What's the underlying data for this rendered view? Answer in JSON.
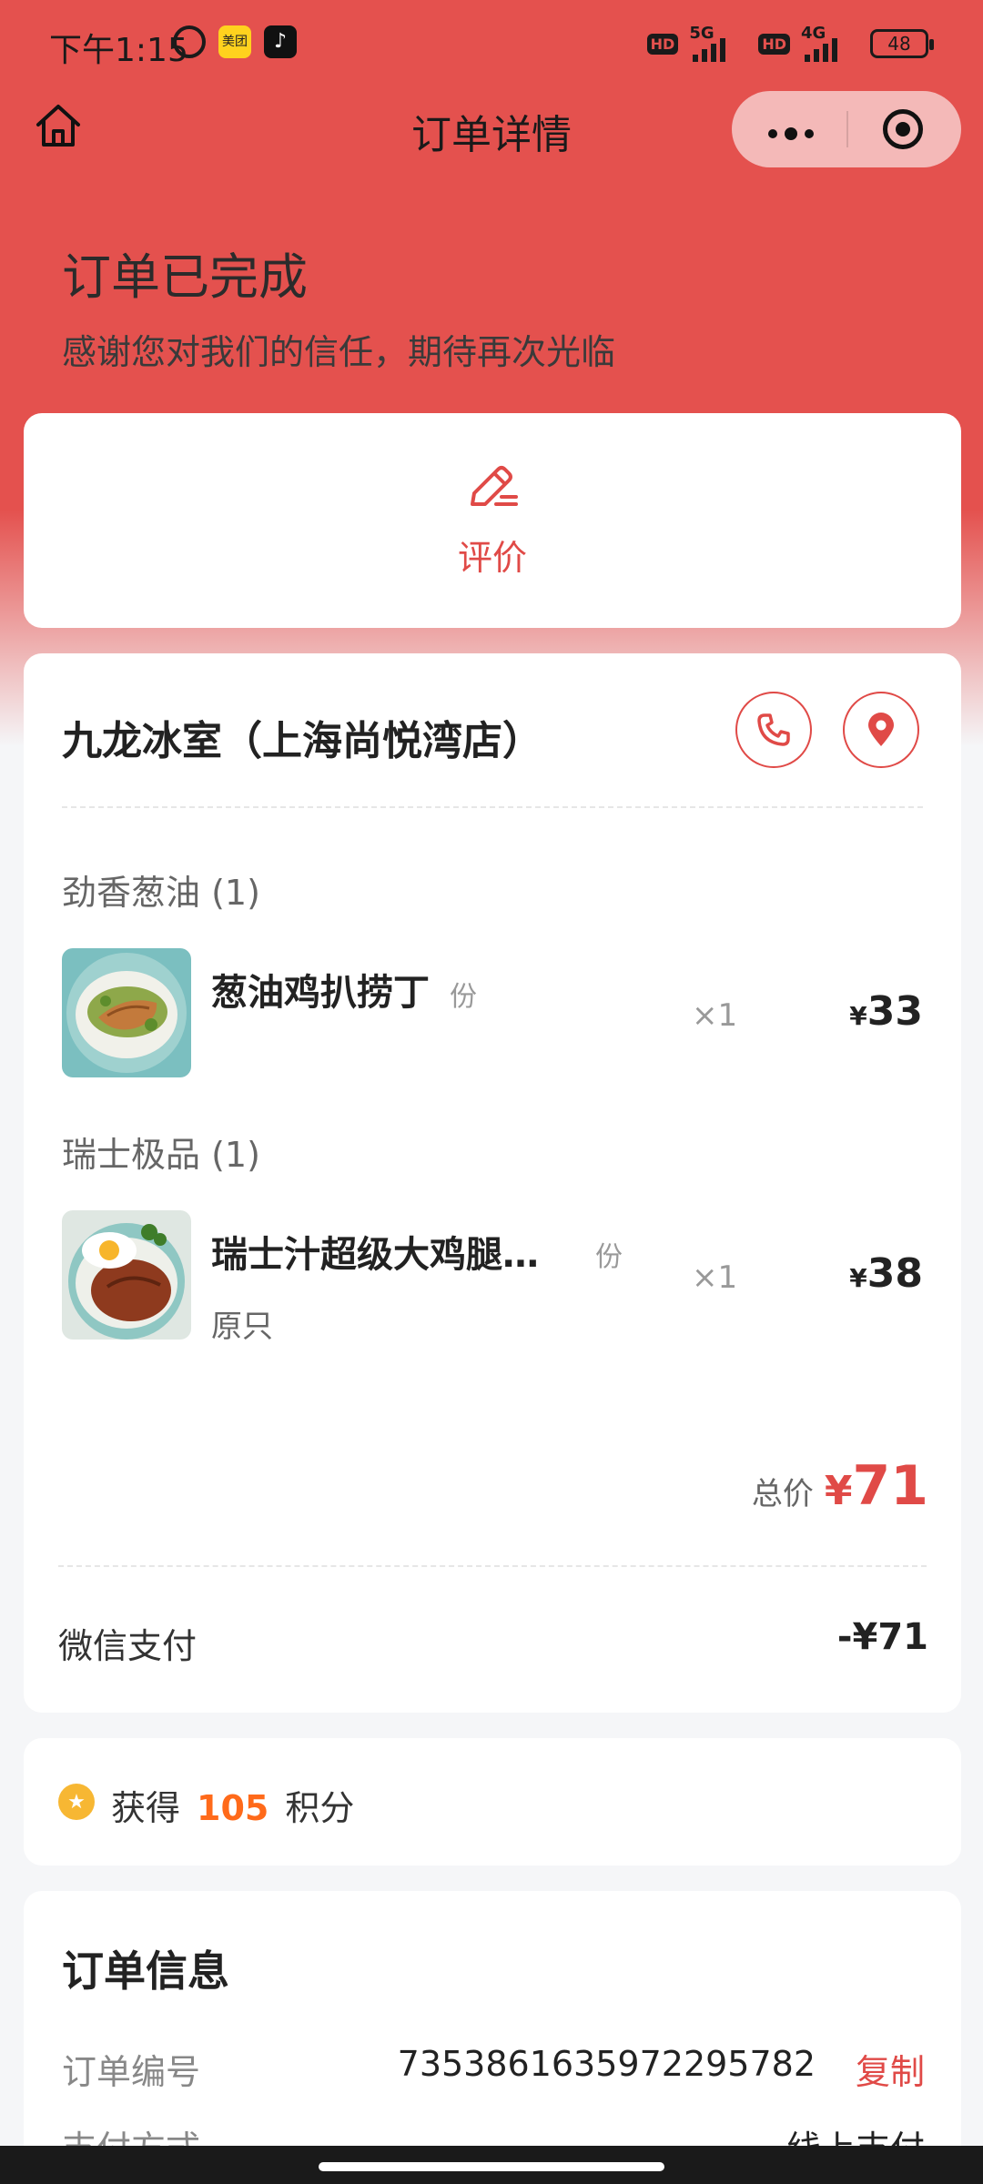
{
  "status_bar": {
    "time": "下午1:15",
    "app_badge_1": "美团",
    "app_badge_2": "♪",
    "hd_label": "HD",
    "net_1": "5G",
    "net_2": "4G",
    "battery": "48"
  },
  "nav": {
    "title": "订单详情"
  },
  "order_status": {
    "title": "订单已完成",
    "subtitle": "感谢您对我们的信任，期待再次光临"
  },
  "review": {
    "label": "评价"
  },
  "shop": {
    "name": "九龙冰室（上海尚悦湾店）"
  },
  "groups": [
    {
      "title": "劲香葱油 (1)",
      "item": {
        "name": "葱油鸡扒捞丁",
        "unit": "份",
        "spec": "",
        "qty": "×1",
        "currency": "¥",
        "price": "33"
      }
    },
    {
      "title": "瑞士极品 (1)",
      "item": {
        "name": "瑞士汁超级大鸡腿…",
        "unit": "份",
        "spec": "原只",
        "qty": "×1",
        "currency": "¥",
        "price": "38"
      }
    }
  ],
  "total": {
    "label": "总价",
    "currency": "¥",
    "amount": "71"
  },
  "payment": {
    "label": "微信支付",
    "amount": "-¥71"
  },
  "points": {
    "prefix": "获得",
    "value": "105",
    "suffix": "积分"
  },
  "order_info": {
    "title": "订单信息",
    "order_no_label": "订单编号",
    "order_no": "7353861635972295782",
    "copy_label": "复制",
    "pay_method_label": "支付方式",
    "pay_method": "线上支付"
  },
  "colors": {
    "brand_red": "#e4514e",
    "accent_red": "#e04a47",
    "points_orange": "#ff6a1a"
  }
}
